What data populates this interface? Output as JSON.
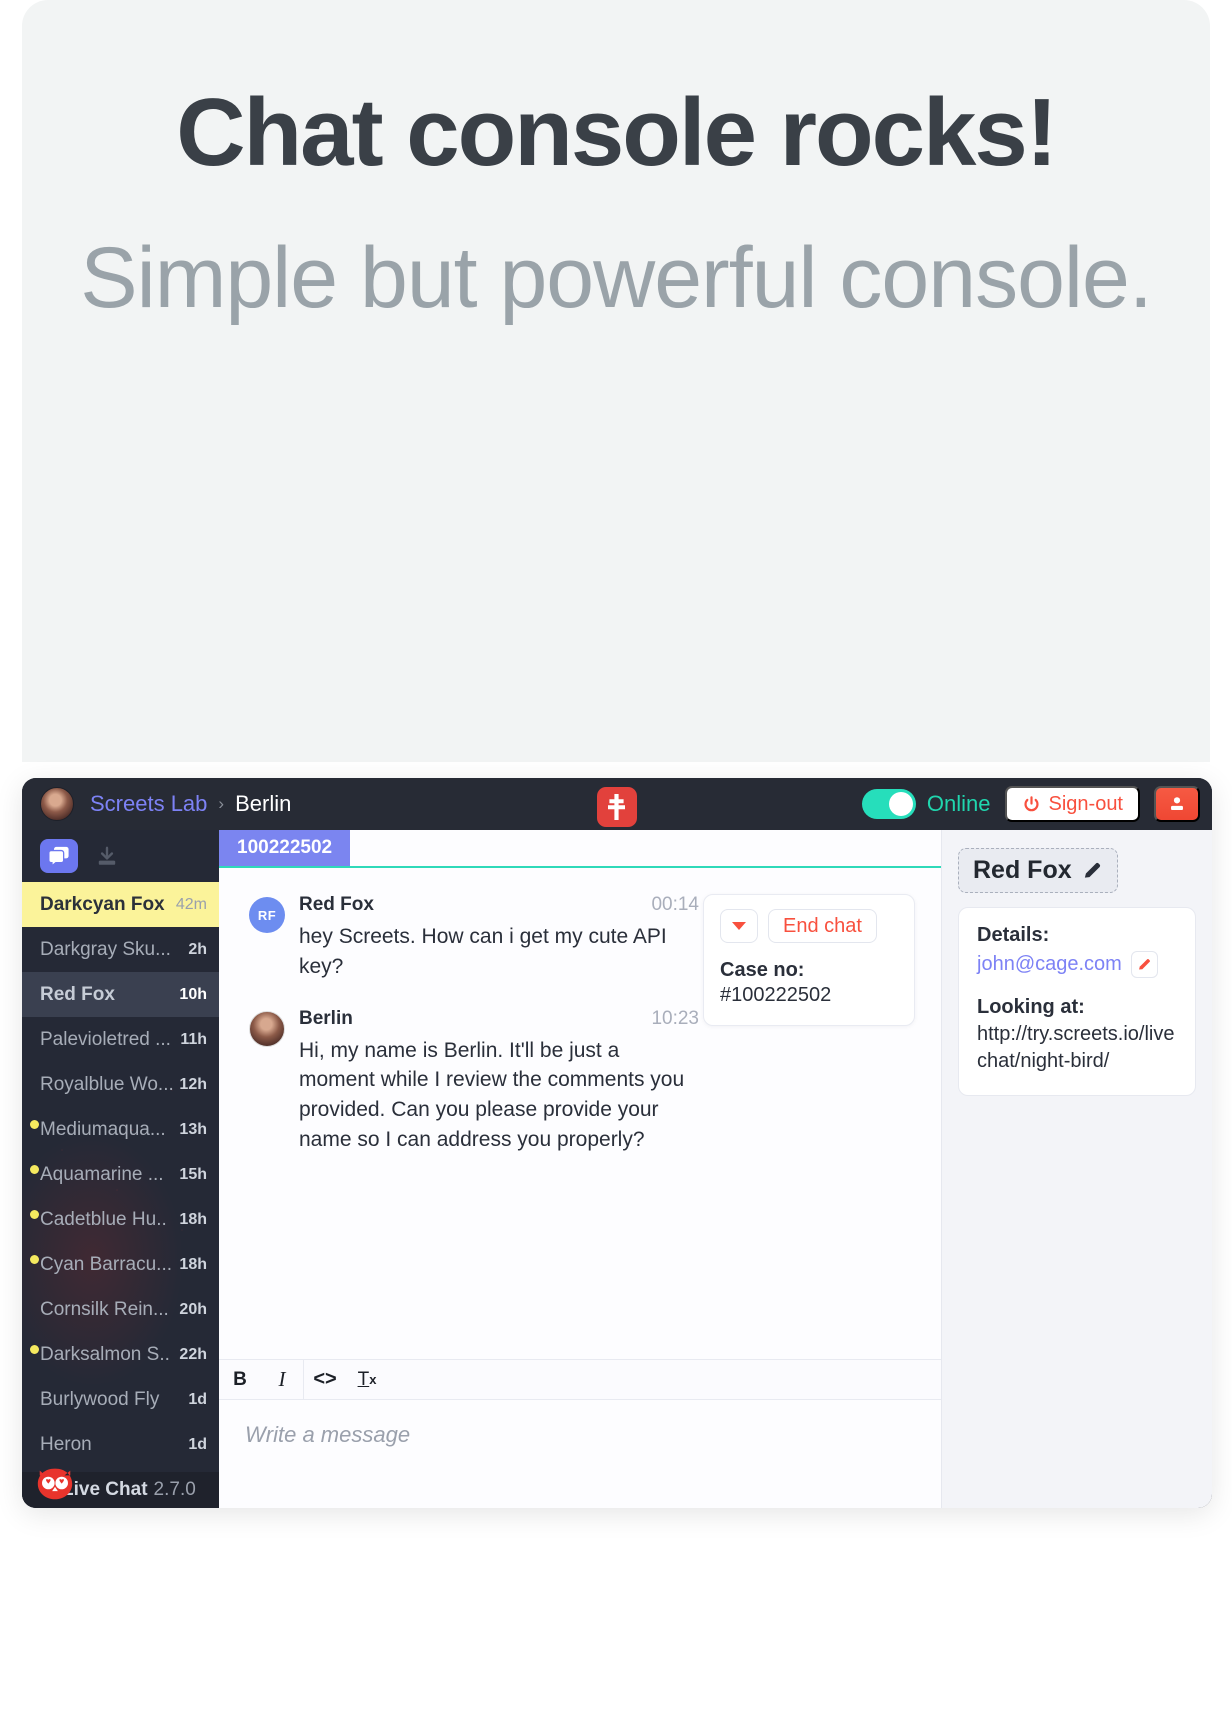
{
  "hero": {
    "headline": "Chat console rocks!",
    "subhead": "Simple but powerful console."
  },
  "topbar": {
    "owner_avatar": "owner-avatar",
    "breadcrumb": {
      "org": "Screets Lab",
      "separator": "›",
      "current": "Berlin"
    },
    "center_logo_icon": "screets-logo-icon",
    "status_toggle": {
      "state": "on",
      "label": "Online",
      "color": "#20d6ae"
    },
    "signout_label": "Sign-out",
    "signout_icon": "power-icon",
    "user_button_icon": "user-add-icon",
    "accent_red": "#f8503e"
  },
  "sidebar": {
    "icons": [
      {
        "name": "chats-icon",
        "active": true
      },
      {
        "name": "inbox-download-icon",
        "active": false
      }
    ],
    "items": [
      {
        "name": "Darkcyan Fox",
        "time": "42m",
        "unread": false,
        "state": "active-yellow"
      },
      {
        "name": "Darkgray Sku...",
        "time": "2h",
        "unread": false,
        "state": "normal"
      },
      {
        "name": "Red Fox",
        "time": "10h",
        "unread": false,
        "state": "selected"
      },
      {
        "name": "Palevioletred ...",
        "time": "11h",
        "unread": false,
        "state": "normal"
      },
      {
        "name": "Royalblue Wo...",
        "time": "12h",
        "unread": false,
        "state": "normal"
      },
      {
        "name": "Mediumaqua...",
        "time": "13h",
        "unread": true,
        "state": "normal"
      },
      {
        "name": "Aquamarine ...",
        "time": "15h",
        "unread": true,
        "state": "normal"
      },
      {
        "name": "Cadetblue Hu..",
        "time": "18h",
        "unread": true,
        "state": "normal"
      },
      {
        "name": "Cyan Barracu...",
        "time": "18h",
        "unread": true,
        "state": "normal"
      },
      {
        "name": "Cornsilk Rein...",
        "time": "20h",
        "unread": false,
        "state": "normal"
      },
      {
        "name": "Darksalmon S..",
        "time": "22h",
        "unread": true,
        "state": "normal"
      },
      {
        "name": "Burlywood Fly",
        "time": "1d",
        "unread": false,
        "state": "normal"
      },
      {
        "name": "Heron",
        "time": "1d",
        "unread": false,
        "state": "normal"
      }
    ],
    "footer": {
      "logo_icon": "owl-logo-icon",
      "product": "Live Chat",
      "version": "2.7.0"
    }
  },
  "center": {
    "case_tab": "100222502",
    "messages": [
      {
        "author": "Red Fox",
        "avatar_kind": "initials",
        "initials": "RF",
        "time": "00:14",
        "text": "hey Screets. How can i get my cute API key?"
      },
      {
        "author": "Berlin",
        "avatar_kind": "photo",
        "initials": "",
        "time": "10:23",
        "text": "Hi, my name is Berlin. It'll be just a moment while I review the comments you provided. Can you please provide your name so I can address you properly?"
      }
    ],
    "end_card": {
      "dropdown_icon": "caret-down-icon",
      "end_chat_label": "End chat",
      "case_label": "Case no:",
      "case_value": "#100222502"
    },
    "composer": {
      "buttons": [
        {
          "name": "bold-button",
          "label": "B"
        },
        {
          "name": "italic-button",
          "label": "I"
        },
        {
          "name": "code-button",
          "label": "<>"
        },
        {
          "name": "clear-format-button",
          "label": "T"
        }
      ],
      "placeholder": "Write a message"
    }
  },
  "right": {
    "visitor_name": "Red Fox",
    "edit_name_icon": "pencil-icon",
    "details_label": "Details:",
    "email": "john@cage.com",
    "edit_email_icon": "pencil-icon",
    "looking_at_label": "Looking at:",
    "looking_at_url": "http://try.screets.io/livechat/night-bird/"
  }
}
